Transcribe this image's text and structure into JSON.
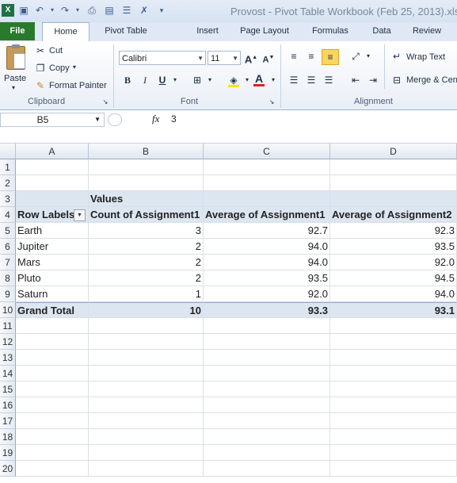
{
  "window": {
    "title": "Provost - Pivot Table Workbook (Feb 25, 2013).xls"
  },
  "quick_access": {
    "save_icon": "save-icon",
    "undo_icon": "undo-icon",
    "redo_icon": "redo-icon"
  },
  "tabs": [
    "File",
    "Home",
    "Pivot Table Wizard",
    "Insert",
    "Page Layout",
    "Formulas",
    "Data",
    "Review"
  ],
  "clipboard": {
    "paste": "Paste",
    "cut": "Cut",
    "copy": "Copy",
    "format_painter": "Format Painter",
    "label": "Clipboard"
  },
  "font": {
    "name": "Calibri",
    "size": "11",
    "label": "Font",
    "bold": "B",
    "italic": "I",
    "underline": "U",
    "grow": "A",
    "shrink": "A"
  },
  "alignment": {
    "wrap_text": "Wrap Text",
    "merge": "Merge & Center",
    "label": "Alignment"
  },
  "formula_bar": {
    "name_box": "B5",
    "fx": "fx",
    "value": "3"
  },
  "columns": [
    "A",
    "B",
    "C",
    "D"
  ],
  "rows": [
    "1",
    "2",
    "3",
    "4",
    "5",
    "6",
    "7",
    "8",
    "9",
    "10",
    "11",
    "12",
    "13",
    "14",
    "15",
    "16",
    "17",
    "18",
    "19",
    "20"
  ],
  "pivot": {
    "values_caption": "Values",
    "headers": [
      "Row Labels",
      "Count of Assignment1",
      "Average of Assignment1",
      "Average of Assignment2"
    ],
    "data": [
      [
        "Earth",
        "3",
        "92.7",
        "92.3"
      ],
      [
        "Jupiter",
        "2",
        "94.0",
        "93.5"
      ],
      [
        "Mars",
        "2",
        "94.0",
        "92.0"
      ],
      [
        "Pluto",
        "2",
        "93.5",
        "94.5"
      ],
      [
        "Saturn",
        "1",
        "92.0",
        "94.0"
      ]
    ],
    "total": [
      "Grand Total",
      "10",
      "93.3",
      "93.1"
    ]
  }
}
